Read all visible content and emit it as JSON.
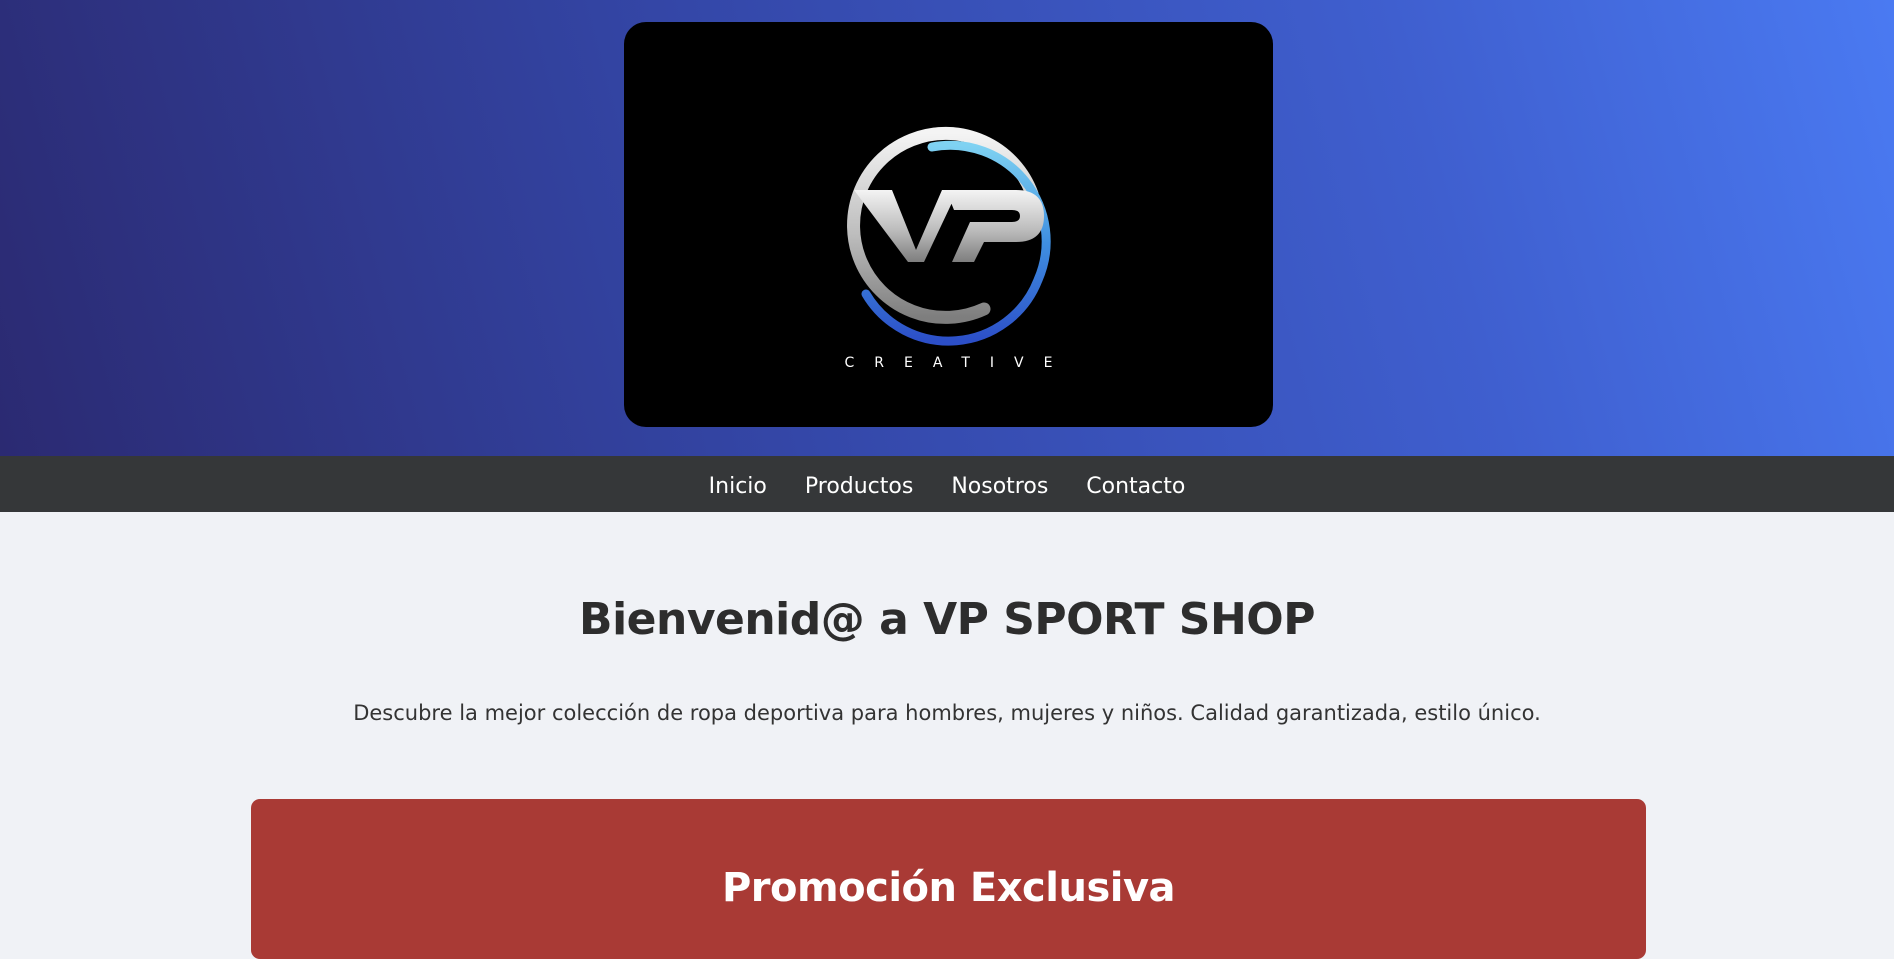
{
  "brand": {
    "logo_letters": "VP",
    "logo_tagline": "CREATIVE"
  },
  "nav": {
    "items": [
      {
        "label": "Inicio"
      },
      {
        "label": "Productos"
      },
      {
        "label": "Nosotros"
      },
      {
        "label": "Contacto"
      }
    ]
  },
  "main": {
    "title": "Bienvenid@ a VP SPORT SHOP",
    "intro": "Descubre la mejor colección de ropa deportiva para hombres, mujeres y niños. Calidad garantizada, estilo único."
  },
  "promo": {
    "title": "Promoción Exclusiva"
  },
  "colors": {
    "hero_gradient_start": "#2b2a72",
    "hero_gradient_end": "#4a7af2",
    "navbar_bg": "#353739",
    "page_bg": "#f0f2f6",
    "promo_bg": "#a93a35",
    "logo_accent_blue": "#4a8fe0"
  }
}
